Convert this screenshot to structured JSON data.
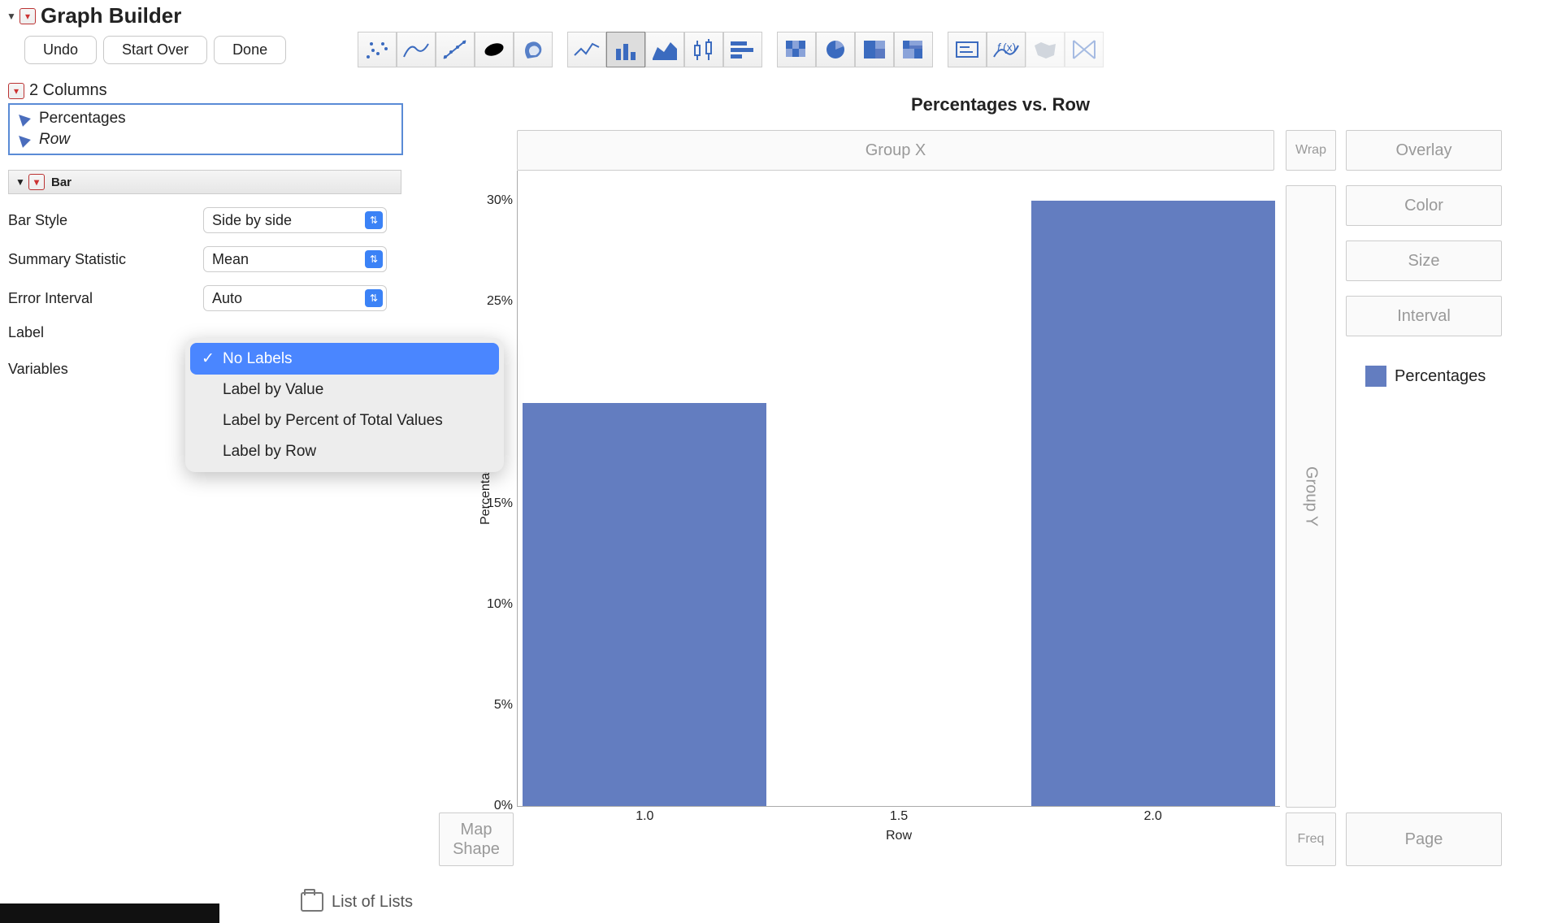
{
  "header": {
    "title": "Graph Builder"
  },
  "actions": {
    "undo": "Undo",
    "start_over": "Start Over",
    "done": "Done"
  },
  "columns_panel": {
    "title_prefix": "2 Columns",
    "items": [
      {
        "label": "Percentages",
        "italic": false
      },
      {
        "label": "Row",
        "italic": true
      }
    ]
  },
  "section": {
    "name": "Bar"
  },
  "props": {
    "bar_style": {
      "label": "Bar Style",
      "value": "Side by side"
    },
    "summary": {
      "label": "Summary Statistic",
      "value": "Mean"
    },
    "error_interval": {
      "label": "Error Interval",
      "value": "Auto"
    },
    "label": {
      "label": "Label"
    },
    "variables": {
      "label": "Variables"
    }
  },
  "label_menu": {
    "selected_index": 0,
    "items": [
      "No Labels",
      "Label by Value",
      "Label by Percent of Total Values",
      "Label by Row"
    ]
  },
  "dropzones": {
    "group_x": "Group X",
    "wrap": "Wrap",
    "overlay": "Overlay",
    "color": "Color",
    "size": "Size",
    "interval": "Interval",
    "group_y": "Group Y",
    "freq": "Freq",
    "page": "Page",
    "map_shape": "Map\nShape"
  },
  "chart": {
    "title": "Percentages vs. Row",
    "legend_label": "Percentages",
    "legend_color": "#637dc0"
  },
  "chart_data": {
    "type": "bar",
    "title": "Percentages vs. Row",
    "xlabel": "Row",
    "ylabel": "Percentages",
    "categories": [
      1.0,
      2.0
    ],
    "values": [
      0.2,
      0.3
    ],
    "x_ticks": [
      1.0,
      1.5,
      2.0
    ],
    "y_ticks": [
      0.05,
      0.1,
      0.15,
      0.25,
      0.3
    ],
    "ylim": [
      0.0,
      0.315
    ],
    "xlim": [
      0.75,
      2.25
    ],
    "y_tick_format": "percent",
    "series_color": "#637dc0"
  },
  "footer": {
    "item": "List of Lists"
  }
}
